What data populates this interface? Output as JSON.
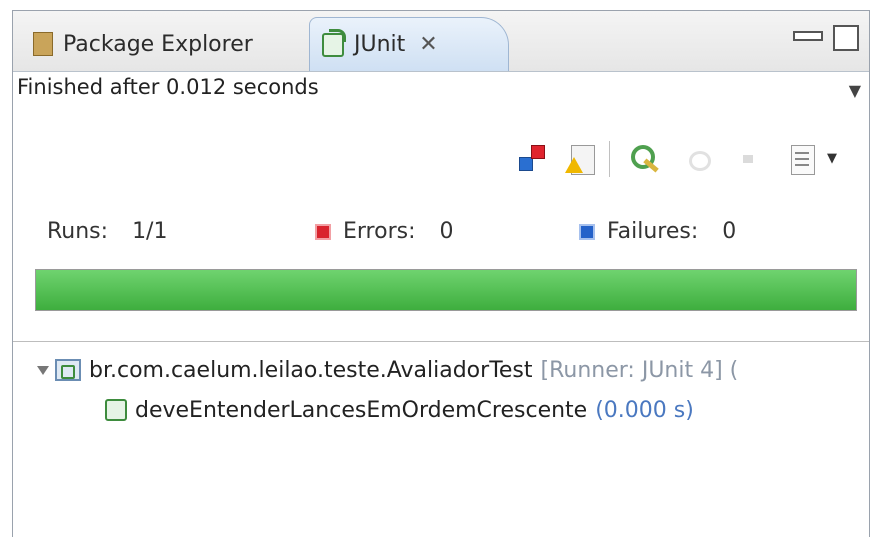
{
  "tabs": [
    {
      "label": "Package Explorer",
      "icon": "package-icon"
    },
    {
      "label": "JUnit",
      "icon": "junit-icon",
      "active": true
    }
  ],
  "status": {
    "text": "Finished after 0.012 seconds"
  },
  "counters": {
    "runs_label": "Runs:",
    "runs_value": "1/1",
    "errors_label": "Errors:",
    "errors_value": "0",
    "failures_label": "Failures:",
    "failures_value": "0"
  },
  "progress": {
    "fraction": 1.0,
    "color": "#4cbb4c"
  },
  "tree": {
    "suite": {
      "name": "br.com.caelum.leilao.teste.AvaliadorTest",
      "runner": "[Runner: JUnit 4] (",
      "state": "passed"
    },
    "tests": [
      {
        "name": "deveEntenderLancesEmOrdemCrescente",
        "time": "(0.000 s)",
        "state": "passed"
      }
    ]
  },
  "toolbar": [
    "error-filter-icon",
    "scroll-lock-warning-icon",
    "rerun-icon",
    "rerun-failed-icon",
    "stop-icon",
    "history-icon"
  ]
}
